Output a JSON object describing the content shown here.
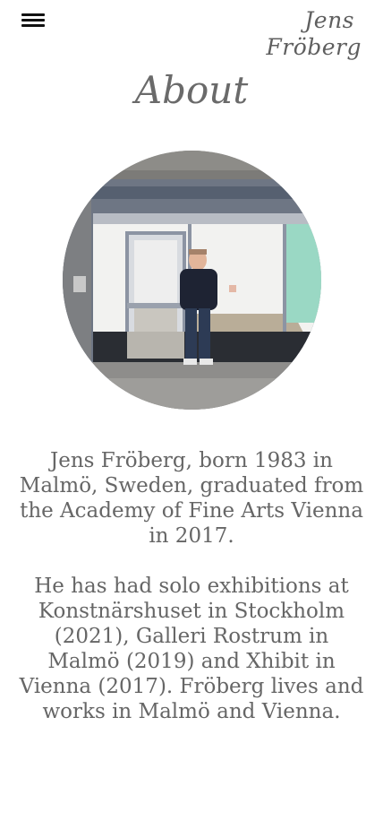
{
  "header": {
    "menu_icon": "hamburger-menu-icon",
    "logo_line1": "Jens",
    "logo_line2": "Fröberg"
  },
  "main": {
    "title": "About",
    "portrait_icon": "artist-portrait-photo",
    "bio": [
      "Jens Fröberg, born 1983 in Malmö, Sweden, graduated from the Academy of Fine Arts Vienna in 2017.",
      "He has had solo exhibitions at Konstnärshuset in Stockholm (2021), Galleri Rostrum in Malmö (2019) and Xhibit in Vienna (2017). Fröberg lives and works in Malmö and Vienna."
    ]
  },
  "colors": {
    "text": "#666666",
    "menu_icon": "#111111",
    "background": "#ffffff"
  }
}
